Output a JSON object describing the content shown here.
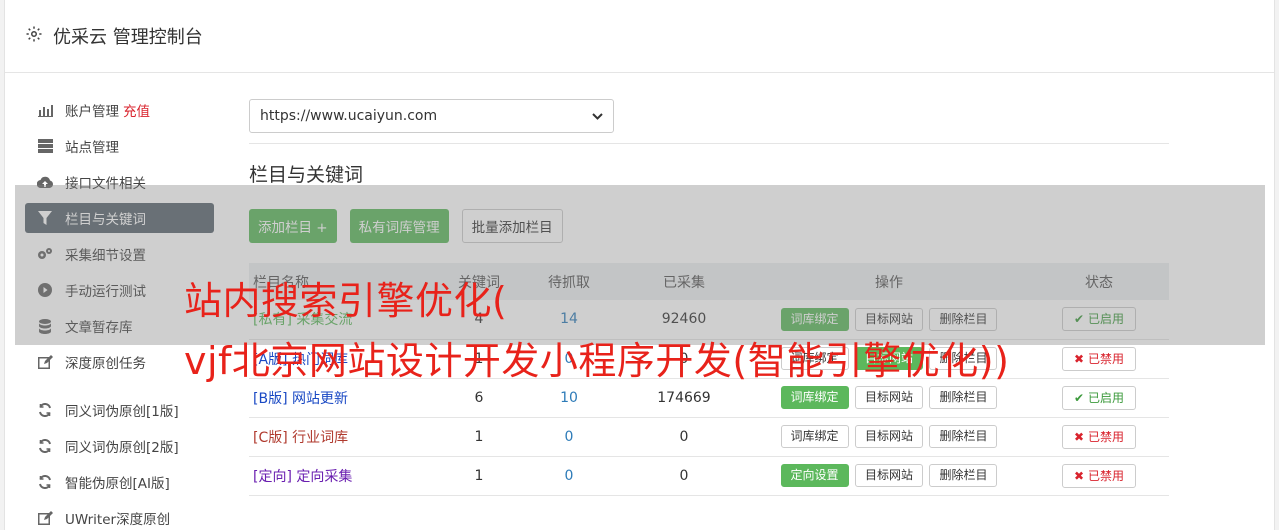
{
  "header": {
    "title": "优采云 管理控制台",
    "icon": "gear-icon"
  },
  "sidebar": {
    "items": [
      {
        "label": "账户管理",
        "extra": "充值",
        "icon": "bar-chart-icon"
      },
      {
        "label": "站点管理",
        "icon": "server-icon"
      },
      {
        "label": "接口文件相关",
        "icon": "cloud-upload-icon"
      },
      {
        "label": "栏目与关键词",
        "icon": "filter-icon",
        "active": true
      },
      {
        "label": "采集细节设置",
        "icon": "cogs-icon"
      },
      {
        "label": "手动运行测试",
        "icon": "play-circle-icon"
      },
      {
        "label": "文章暂存库",
        "icon": "database-icon"
      },
      {
        "label": "深度原创任务",
        "icon": "edit-icon"
      },
      {
        "label": "同义词伪原创[1版]",
        "icon": "refresh-icon"
      },
      {
        "label": "同义词伪原创[2版]",
        "icon": "refresh-icon"
      },
      {
        "label": "智能伪原创[AI版]",
        "icon": "refresh-icon"
      },
      {
        "label": "UWriter深度原创",
        "icon": "edit-icon"
      }
    ]
  },
  "main": {
    "site_select": "https://www.ucaiyun.com",
    "section_title": "栏目与关键词",
    "buttons": {
      "add": "添加栏目 +",
      "private": "私有词库管理",
      "batch": "批量添加栏目"
    },
    "table": {
      "headers": [
        "栏目名称",
        "关键词",
        "待抓取",
        "已采集",
        "操作",
        "状态"
      ],
      "rows": [
        {
          "tag": "[私有]",
          "name": "采集交流",
          "kw": "4",
          "pending": "14",
          "collected": "92460",
          "op1": "词库绑定",
          "op2": "目标网站",
          "op3": "删除栏目",
          "status": "已启用",
          "status_on": true
        },
        {
          "tag": "[A版]",
          "name": "热门词库",
          "kw": "1",
          "pending": "0",
          "collected": "0",
          "op1": "词库绑定",
          "op2": "目标网站",
          "op3": "删除栏目",
          "status": "已禁用",
          "status_on": false
        },
        {
          "tag": "[B版]",
          "name": "网站更新",
          "kw": "6",
          "pending": "10",
          "collected": "174669",
          "op1": "词库绑定",
          "op2": "目标网站",
          "op3": "删除栏目",
          "status": "已启用",
          "status_on": true
        },
        {
          "tag": "[C版]",
          "name": "行业词库",
          "kw": "1",
          "pending": "0",
          "collected": "0",
          "op1": "词库绑定",
          "op2": "目标网站",
          "op3": "删除栏目",
          "status": "已禁用",
          "status_on": false
        },
        {
          "tag": "[定向]",
          "name": "定向采集",
          "kw": "1",
          "pending": "0",
          "collected": "0",
          "op1": "定向设置",
          "op2": "目标网站",
          "op3": "删除栏目",
          "status": "已禁用",
          "status_on": false
        }
      ]
    }
  },
  "overlay": {
    "line1": "站内搜索引擎优化(",
    "line2": "vjf北京网站设计开发小程序开发(智能引擎优化))"
  }
}
